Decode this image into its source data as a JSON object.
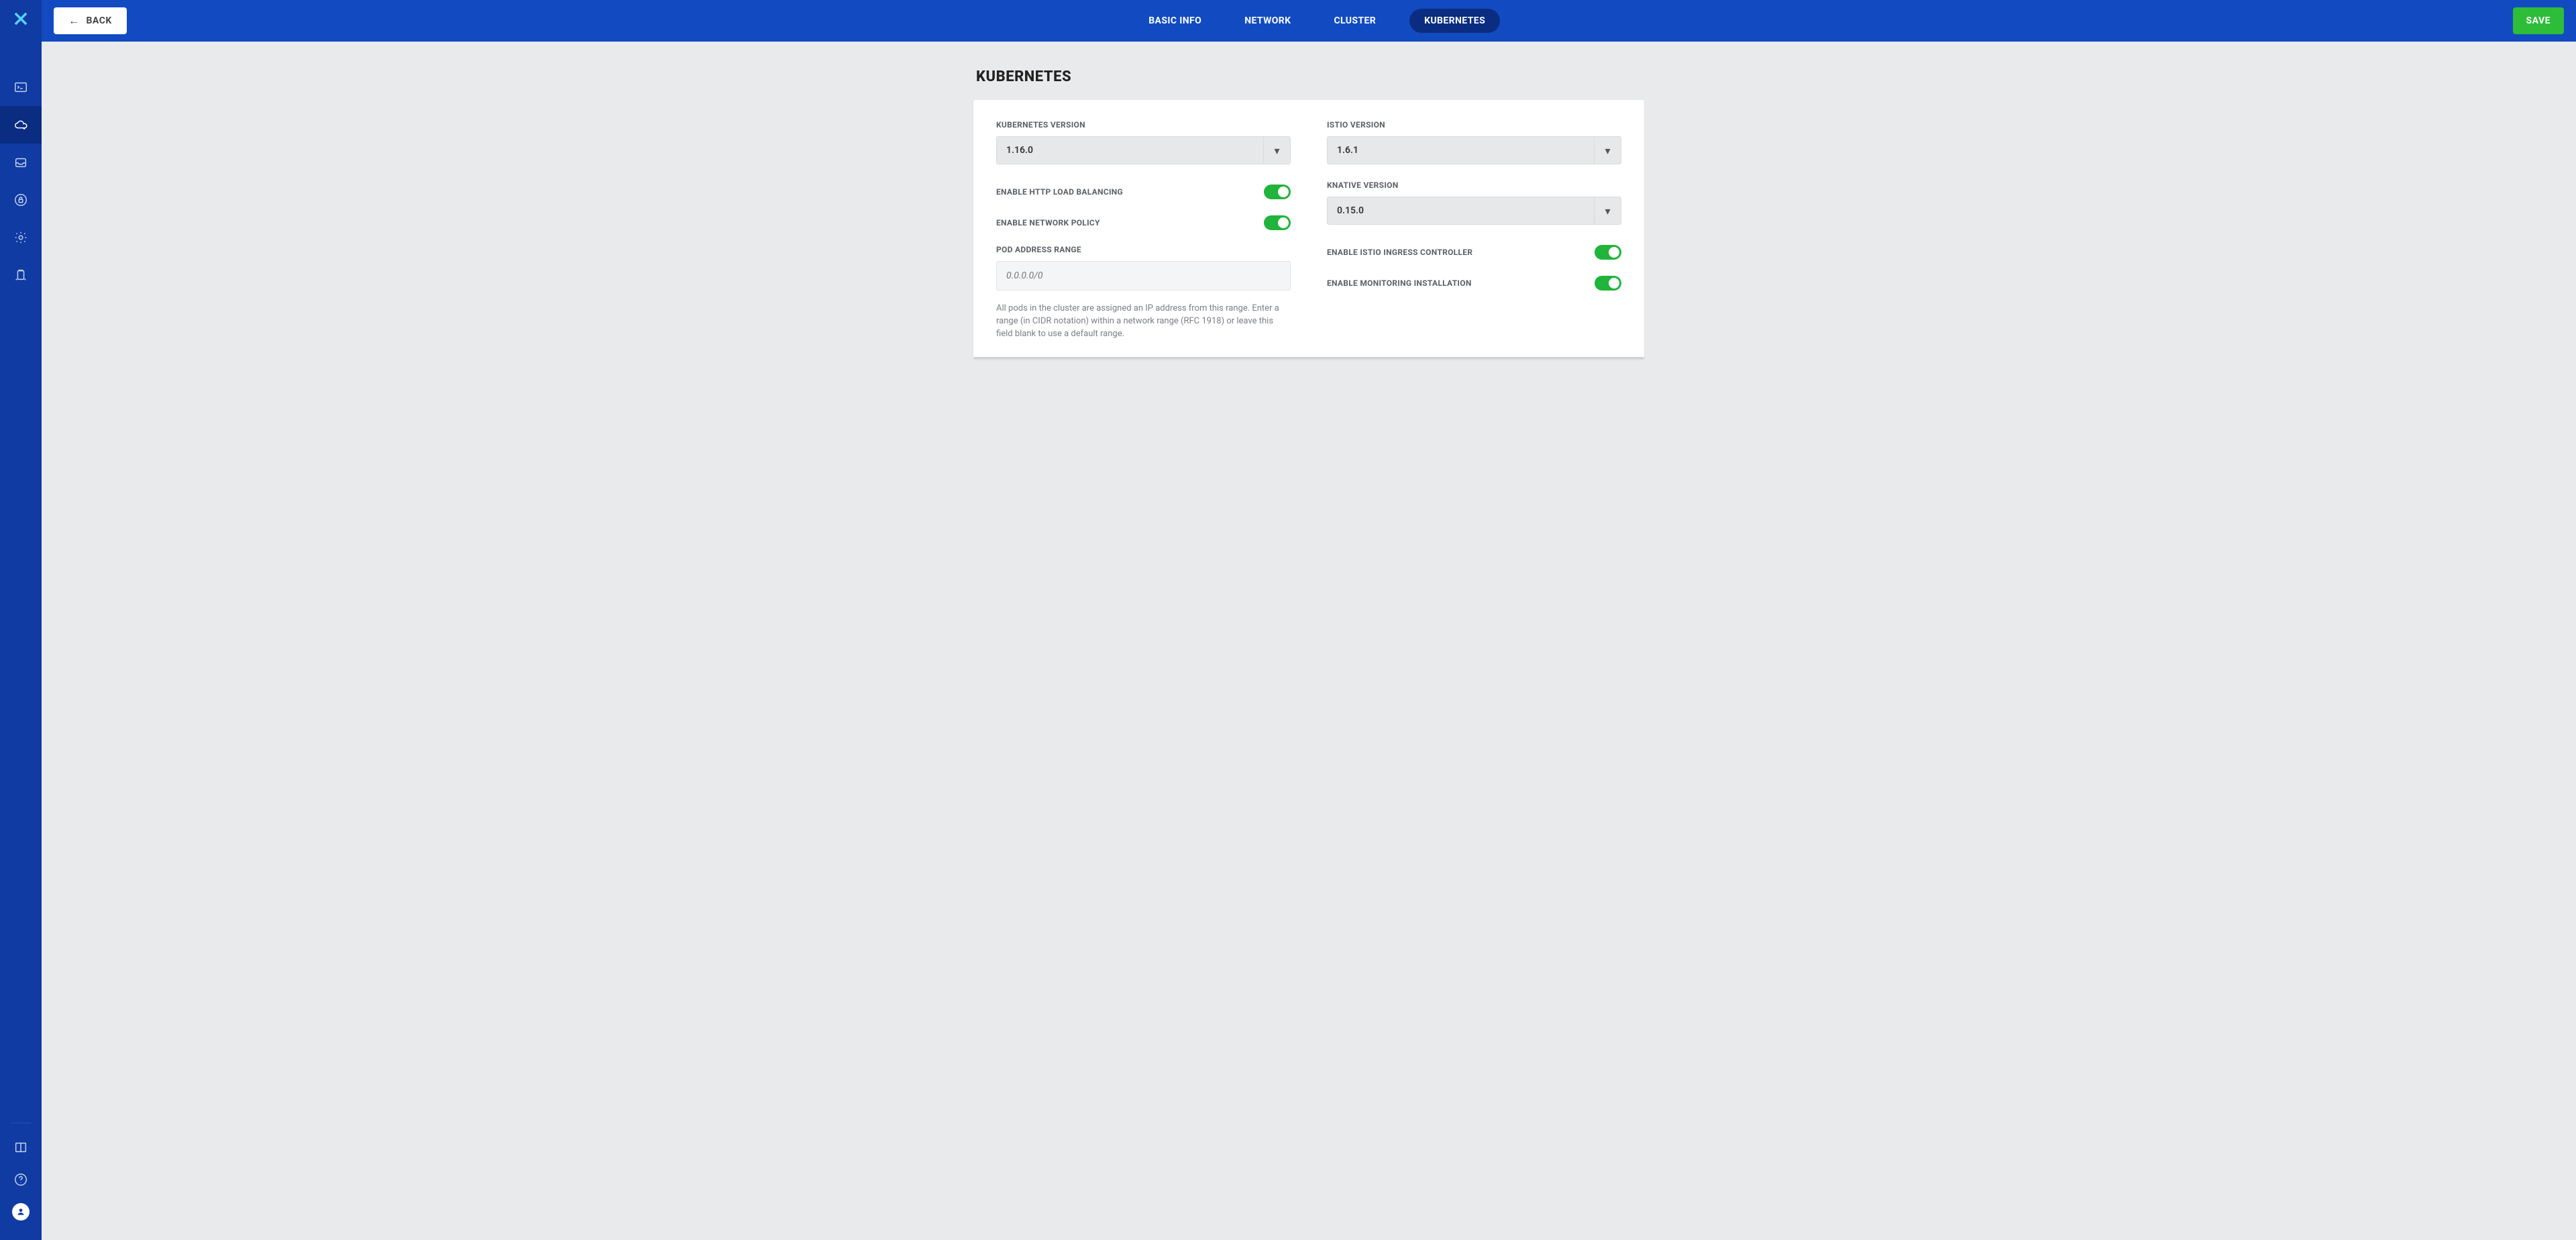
{
  "header": {
    "back_label": "BACK",
    "save_label": "SAVE",
    "tabs": [
      "BASIC INFO",
      "NETWORK",
      "CLUSTER",
      "KUBERNETES"
    ],
    "active_tab": 3
  },
  "page": {
    "title": "KUBERNETES"
  },
  "left": {
    "k8s_version_label": "KUBERNETES VERSION",
    "k8s_version_value": "1.16.0",
    "http_lb_label": "ENABLE HTTP LOAD BALANCING",
    "http_lb_on": true,
    "net_policy_label": "ENABLE NETWORK POLICY",
    "net_policy_on": true,
    "pod_range_label": "POD ADDRESS RANGE",
    "pod_range_placeholder": "0.0.0.0/0",
    "pod_range_help": "All pods in the cluster are assigned an IP address from this range. Enter a range (in CIDR notation) within a network range (RFC 1918) or leave this field blank to use a default range."
  },
  "right": {
    "istio_version_label": "ISTIO VERSION",
    "istio_version_value": "1.6.1",
    "knative_version_label": "KNATIVE VERSION",
    "knative_version_value": "0.15.0",
    "istio_ingress_label": "ENABLE ISTIO INGRESS CONTROLLER",
    "istio_ingress_on": true,
    "monitoring_label": "ENABLE MONITORING INSTALLATION",
    "monitoring_on": true
  },
  "sidebar": {
    "icons": [
      "terminal-icon",
      "cloud-icon",
      "inbox-icon",
      "lock-icon",
      "gear-icon",
      "clipboard-icon",
      "book-icon",
      "help-icon",
      "user-icon"
    ],
    "active": 1
  }
}
